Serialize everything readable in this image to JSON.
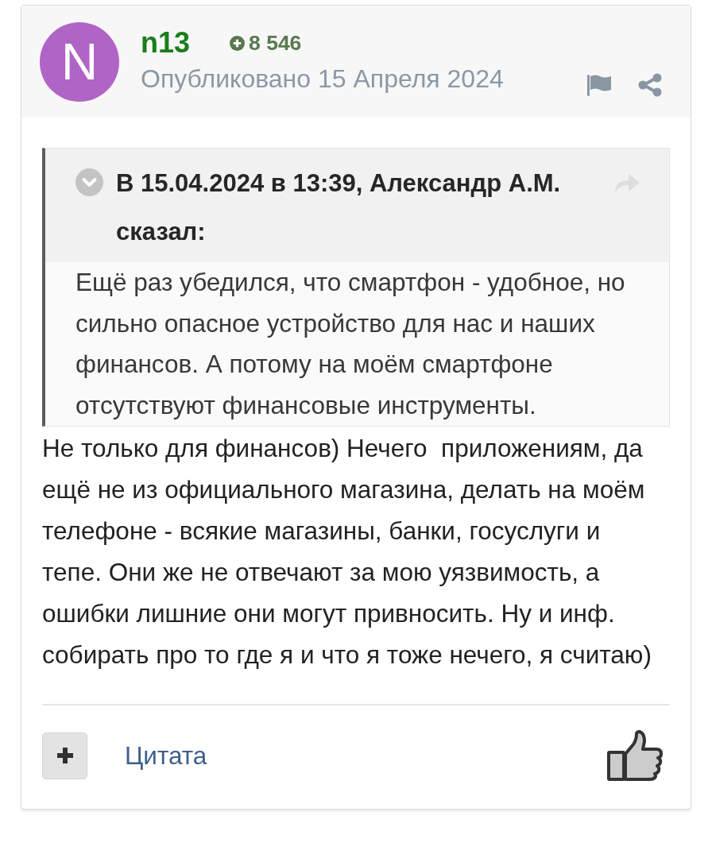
{
  "post": {
    "avatar_letter": "N",
    "author": "n13",
    "reputation": "8 546",
    "published": "Опубликовано 15 Апреля 2024"
  },
  "quote": {
    "citation": "В 15.04.2024 в 13:39, Александр А.М. сказал:",
    "text": "Ещё раз убедился, что смартфон - удобное, но сильно опасное устройство для нас и наших финансов. А потому на моём смартфоне отсутствуют финансовые инструменты."
  },
  "body": "Не только для финансов) Нечего  приложениям, да ещё не из официального магазина, делать на моём телефоне - всякие магазины, банки, госуслуги и тепе. Они же не отвечают за мою уязвимость, а ошибки лишние они могут привносить. Ну и инф. собирать про то где я и что я тоже нечего, я считаю)",
  "footer": {
    "quote_link": "Цитата"
  }
}
